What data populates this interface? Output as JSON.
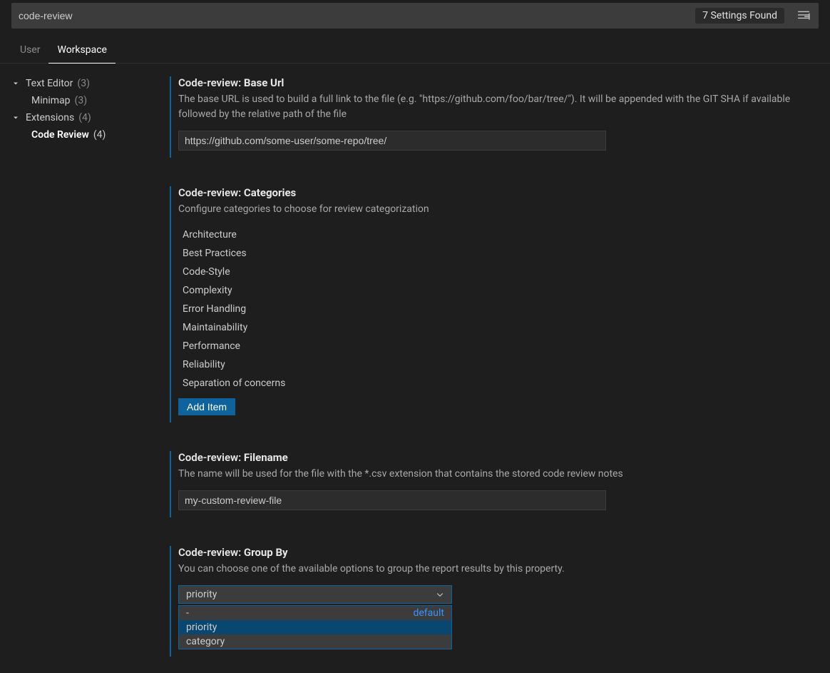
{
  "search": {
    "value": "code-review",
    "results_text": "7 Settings Found"
  },
  "tabs": {
    "user": "User",
    "workspace": "Workspace"
  },
  "toc": {
    "text_editor": {
      "label": "Text Editor",
      "count": "(3)"
    },
    "minimap": {
      "label": "Minimap",
      "count": "(3)"
    },
    "extensions": {
      "label": "Extensions",
      "count": "(4)"
    },
    "code_review": {
      "label": "Code Review",
      "count": "(4)"
    }
  },
  "settings": {
    "base_url": {
      "prefix": "Code-review: ",
      "name": "Base Url",
      "desc": "The base URL is used to build a full link to the file (e.g. \"https://github.com/foo/bar/tree/\"). It will be appended with the GIT SHA if available followed by the relative path of the file",
      "value": "https://github.com/some-user/some-repo/tree/"
    },
    "categories": {
      "prefix": "Code-review: ",
      "name": "Categories",
      "desc": "Configure categories to choose for review categorization",
      "items": [
        "Architecture",
        "Best Practices",
        "Code-Style",
        "Complexity",
        "Error Handling",
        "Maintainability",
        "Performance",
        "Reliability",
        "Separation of concerns"
      ],
      "add_label": "Add Item"
    },
    "filename": {
      "prefix": "Code-review: ",
      "name": "Filename",
      "desc": "The name will be used for the file with the *.csv extension that contains the stored code review notes",
      "value": "my-custom-review-file"
    },
    "group_by": {
      "prefix": "Code-review: ",
      "name": "Group By",
      "desc": "You can choose one of the available options to group the report results by this property.",
      "selected": "priority",
      "options": [
        {
          "label": "-",
          "default_badge": "default"
        },
        {
          "label": "priority",
          "default_badge": ""
        },
        {
          "label": "category",
          "default_badge": ""
        }
      ]
    }
  }
}
